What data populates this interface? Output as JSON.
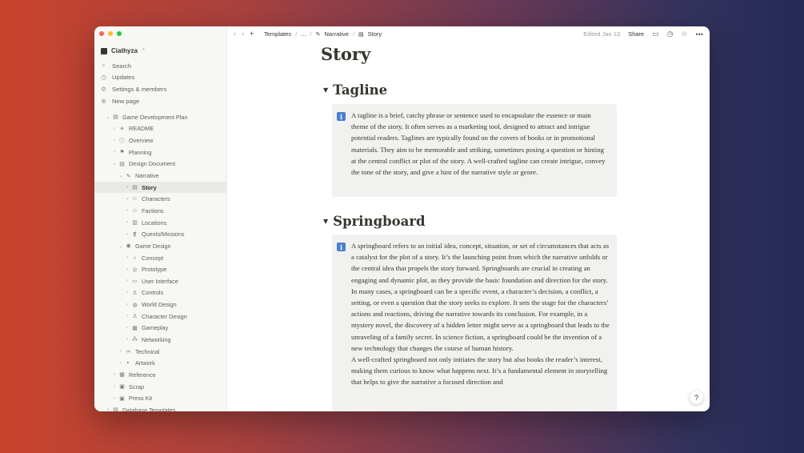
{
  "sidebar": {
    "workspace_name": "Ciathyza",
    "menu": [
      {
        "label": "Search",
        "icon": "search-icon"
      },
      {
        "label": "Updates",
        "icon": "clock-icon"
      },
      {
        "label": "Settings & members",
        "icon": "gear-icon"
      },
      {
        "label": "New page",
        "icon": "plus-circle-icon"
      }
    ],
    "tree": [
      {
        "label": "Game Development Plan",
        "depth": 1,
        "expanded": true
      },
      {
        "label": "README",
        "depth": 2,
        "expanded": false
      },
      {
        "label": "Overview",
        "depth": 2,
        "expanded": false
      },
      {
        "label": "Planning",
        "depth": 2,
        "expanded": false
      },
      {
        "label": "Design Document",
        "depth": 2,
        "expanded": true
      },
      {
        "label": "Narrative",
        "depth": 3,
        "expanded": true
      },
      {
        "label": "Story",
        "depth": 4,
        "expanded": false,
        "selected": true
      },
      {
        "label": "Characters",
        "depth": 4,
        "expanded": false
      },
      {
        "label": "Factions",
        "depth": 4,
        "expanded": false
      },
      {
        "label": "Locations",
        "depth": 4,
        "expanded": false
      },
      {
        "label": "Quests/Missions",
        "depth": 4,
        "expanded": false
      },
      {
        "label": "Game Design",
        "depth": 3,
        "expanded": true
      },
      {
        "label": "Concept",
        "depth": 4,
        "expanded": false
      },
      {
        "label": "Prototype",
        "depth": 4,
        "expanded": false
      },
      {
        "label": "User Interface",
        "depth": 4,
        "expanded": false
      },
      {
        "label": "Controls",
        "depth": 4,
        "expanded": false
      },
      {
        "label": "World Design",
        "depth": 4,
        "expanded": false
      },
      {
        "label": "Character Design",
        "depth": 4,
        "expanded": false
      },
      {
        "label": "Gameplay",
        "depth": 4,
        "expanded": false
      },
      {
        "label": "Networking",
        "depth": 4,
        "expanded": false
      },
      {
        "label": "Technical",
        "depth": 3,
        "expanded": false
      },
      {
        "label": "Artwork",
        "depth": 3,
        "expanded": false
      },
      {
        "label": "Reference",
        "depth": 2,
        "expanded": false
      },
      {
        "label": "Scrap",
        "depth": 2,
        "expanded": false
      },
      {
        "label": "Press Kit",
        "depth": 2,
        "expanded": false
      },
      {
        "label": "Database Templates",
        "depth": 1,
        "expanded": false
      }
    ]
  },
  "topbar": {
    "breadcrumbs": [
      "Templates",
      "...",
      "Narrative",
      "Story"
    ],
    "edited": "Edited Jan 13",
    "share_label": "Share"
  },
  "page": {
    "title": "Story",
    "sections": [
      {
        "heading": "Tagline",
        "paragraphs": [
          "A tagline is a brief, catchy phrase or sentence used to encapsulate the essence or main theme of the story. It often serves as a marketing tool, designed to attract and intrigue potential readers. Taglines are typically found on the covers of books or in promotional materials. They aim to be memorable and striking, sometimes posing a question or hinting at the central conflict or plot of the story. A well-crafted tagline can create intrigue, convey the tone of the story, and give a hint of the narrative style or genre."
        ]
      },
      {
        "heading": "Springboard",
        "paragraphs": [
          "A springboard refers to an initial idea, concept, situation, or set of circumstances that acts as a catalyst for the plot of a story. It’s the launching point from which the narrative unfolds or the central idea that propels the story forward. Springboards are crucial in creating an engaging and dynamic plot, as they provide the basic foundation and direction for the story.",
          "In many cases, a springboard can be a specific event, a character’s decision, a conflict, a setting, or even a question that the story seeks to explore. It sets the stage for the characters’ actions and reactions, driving the narrative towards its conclusion. For example, in a mystery novel, the discovery of a hidden letter might serve as a springboard that leads to the unraveling of a family secret. In science fiction, a springboard could be the invention of a new technology that changes the course of human history.",
          "A well-crafted springboard not only initiates the story but also hooks the reader’s interest, making them curious to know what happens next. It’s a fundamental element in storytelling that helps to give the narrative a focused direction and"
        ]
      }
    ]
  },
  "help_label": "?"
}
